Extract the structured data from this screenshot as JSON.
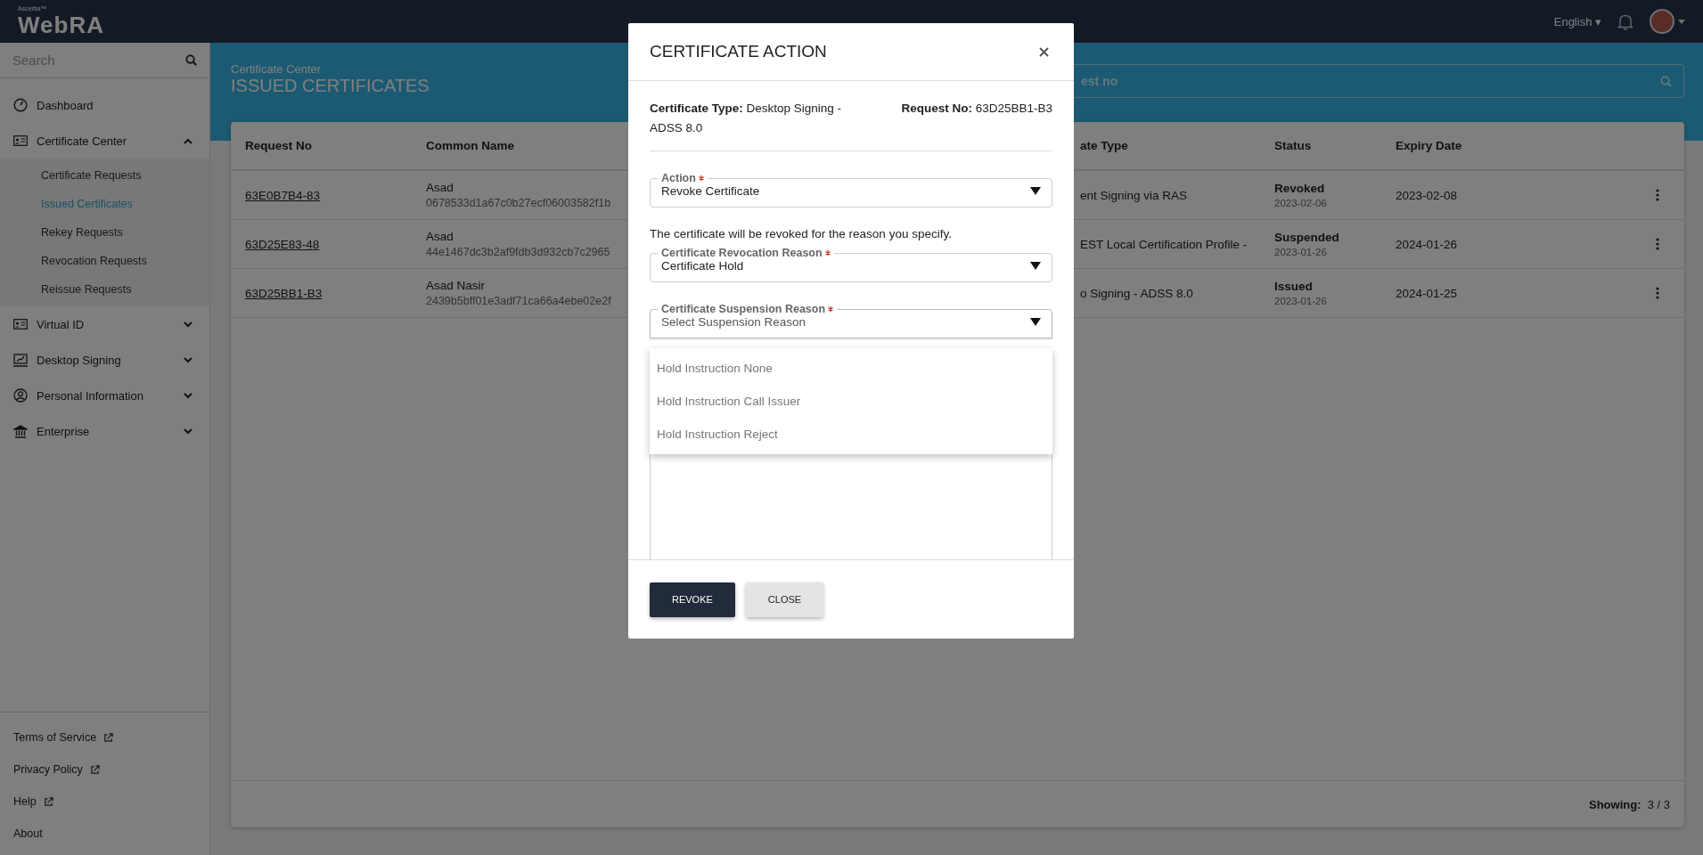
{
  "header": {
    "logo_small": "Ascertia™",
    "logo": "WebRA",
    "language": "English",
    "language_caret": "▾"
  },
  "sidebar": {
    "search": {
      "placeholder": "Search"
    },
    "items": [
      {
        "label": "Dashboard",
        "kind": "link"
      },
      {
        "label": "Certificate Center",
        "kind": "group",
        "expanded": true,
        "children": [
          {
            "label": "Certificate Requests",
            "selected": false
          },
          {
            "label": "Issued Certificates",
            "selected": true
          },
          {
            "label": "Rekey Requests",
            "selected": false
          },
          {
            "label": "Revocation Requests",
            "selected": false
          },
          {
            "label": "Reissue Requests",
            "selected": false
          }
        ]
      },
      {
        "label": "Virtual ID",
        "kind": "group",
        "expanded": false
      },
      {
        "label": "Desktop Signing",
        "kind": "group",
        "expanded": false
      },
      {
        "label": "Personal Information",
        "kind": "group",
        "expanded": false
      },
      {
        "label": "Enterprise",
        "kind": "group",
        "expanded": false
      }
    ],
    "footer_links": [
      {
        "label": "Terms of Service",
        "external": true
      },
      {
        "label": "Privacy Policy",
        "external": true
      },
      {
        "label": "Help",
        "external": true
      },
      {
        "label": "About",
        "external": false
      }
    ]
  },
  "banner": {
    "breadcrumb": "Certificate Center",
    "title": "ISSUED CERTIFICATES",
    "search": {
      "placeholder": "est no"
    }
  },
  "table": {
    "columns": [
      "Request No",
      "Common Name",
      "ate Type",
      "Status",
      "Expiry Date"
    ],
    "rows": [
      {
        "request_no": "63E0B7B4-83",
        "common_name": "Asad",
        "common_name_sub": "0678533d1a67c0b27ecf06003582f1b",
        "certificate_type": "ent Signing via RAS",
        "status": "Revoked",
        "status_date": "2023-02-06",
        "expiry_date": "2023-02-08"
      },
      {
        "request_no": "63D25E83-48",
        "common_name": "Asad",
        "common_name_sub": "44e1467dc3b2af9fdb3d932cb7c2965",
        "certificate_type": "EST Local Certification Profile -",
        "status": "Suspended",
        "status_date": "2023-01-26",
        "expiry_date": "2024-01-26"
      },
      {
        "request_no": "63D25BB1-B3",
        "common_name": "Asad Nasir",
        "common_name_sub": "2439b5bff01e3adf71ca66a4ebe02e2f",
        "certificate_type": "o Signing - ADSS 8.0",
        "status": "Issued",
        "status_date": "2023-01-26",
        "expiry_date": "2024-01-25"
      }
    ],
    "footer": "**Showing:**  3 / 3"
  },
  "modal": {
    "title": "CERTIFICATE ACTION",
    "info": [
      "**Certificate Type:** Desktop Signing - ADSS 8.0",
      "**Request No:** 63D25BB1-B3"
    ],
    "body": [
      {
        "kind": "select",
        "label": "Action",
        "required": true,
        "value": "Revoke Certificate"
      },
      {
        "kind": "note",
        "text": "The certificate will be revoked for the reason you specify."
      },
      {
        "kind": "select",
        "label": "Certificate Revocation Reason",
        "required": true,
        "value": "Certificate Hold"
      },
      {
        "kind": "select",
        "label": "Certificate Suspension Reason",
        "required": true,
        "placeholder": "Select Suspension Reason",
        "expanded": true,
        "options": [
          "Hold Instruction None",
          "Hold Instruction Call Issuer",
          "Hold Instruction Reject"
        ]
      },
      {
        "kind": "textarea"
      }
    ],
    "buttons": [
      {
        "label": "REVOKE",
        "kind": "primary"
      },
      {
        "label": "CLOSE",
        "kind": "secondary"
      }
    ]
  }
}
